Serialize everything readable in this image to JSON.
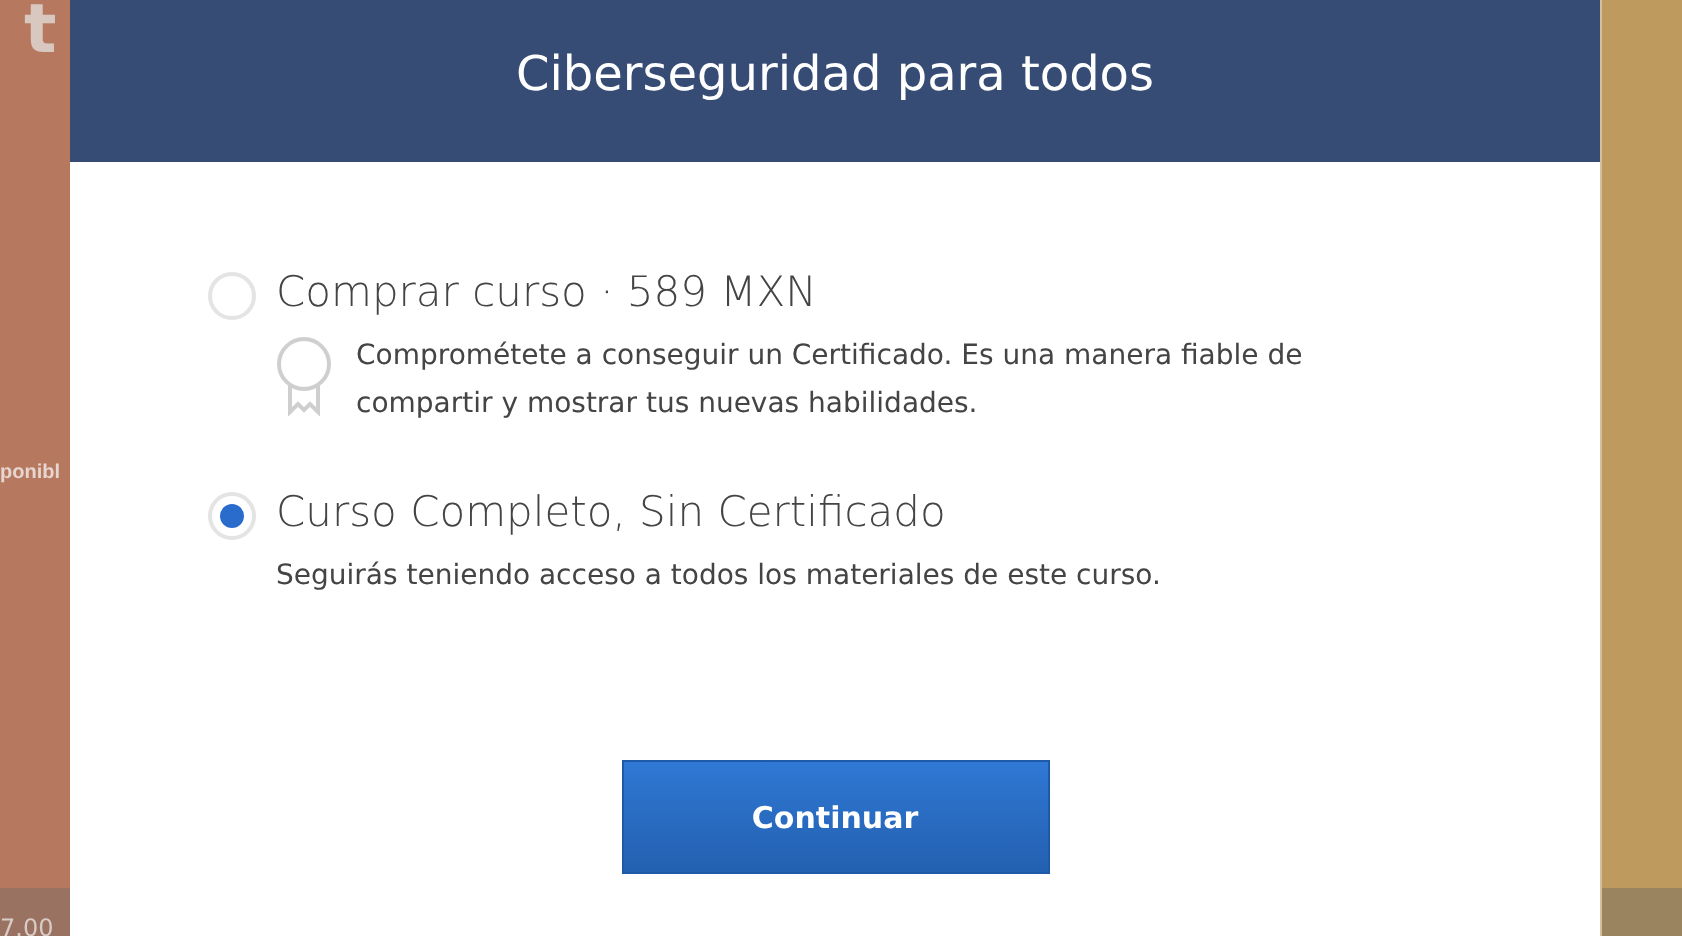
{
  "background": {
    "heading_fragment": "t",
    "label_fragment": "ponibl",
    "price_fragment": "7.00"
  },
  "modal": {
    "title": "Ciberseguridad para todos",
    "options": [
      {
        "kind": "certificate",
        "title": "Comprar curso · 589 MXN",
        "description": "Comprométete a conseguir un Certificado. Es una manera fiable de compartir y mostrar tus nuevas habilidades.",
        "selected": false
      },
      {
        "kind": "plain",
        "title": "Curso Completo, Sin Certificado",
        "description": "Seguirás teniendo acceso a todos los materiales de este curso.",
        "selected": true
      }
    ],
    "button": "Continuar"
  }
}
